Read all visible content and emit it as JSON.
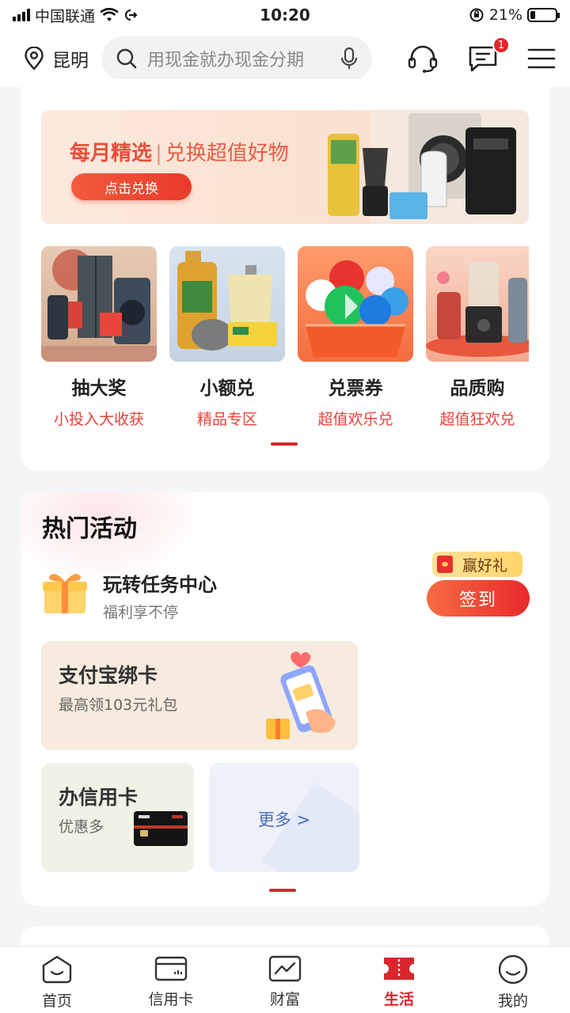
{
  "status_bar": {
    "carrier": "中国联通",
    "time": "10:20",
    "battery": "21%",
    "battery_level": 0.21
  },
  "header": {
    "location": "昆明",
    "search_placeholder": "用现金就办现金分期",
    "message_badge": "1",
    "icons": [
      "location-pin-icon",
      "search-icon",
      "microphone-icon",
      "headset-icon",
      "message-icon",
      "menu-icon"
    ]
  },
  "banner": {
    "title": "每月精选",
    "subtitle": "兑换超值好物",
    "button": "点击兑换"
  },
  "products": [
    {
      "name": "抽大奖",
      "sub": "小投入大收获"
    },
    {
      "name": "小额兑",
      "sub": "精品专区"
    },
    {
      "name": "兑票券",
      "sub": "超值欢乐兑"
    },
    {
      "name": "品质购",
      "sub": "超值狂欢兑"
    }
  ],
  "hot": {
    "title": "热门活动",
    "task_title": "玩转任务中心",
    "task_sub": "福利享不停",
    "win_tag": "赢好礼",
    "sign_button": "签到",
    "tiles": {
      "alipay_title": "支付宝绑卡",
      "alipay_sub": "最高领103元礼包",
      "credit_title": "办信用卡",
      "credit_sub": "优惠多",
      "more": "更多 >"
    }
  },
  "tabbar": [
    {
      "label": "首页",
      "active": false
    },
    {
      "label": "信用卡",
      "active": false
    },
    {
      "label": "财富",
      "active": false
    },
    {
      "label": "生活",
      "active": true
    },
    {
      "label": "我的",
      "active": false
    }
  ],
  "colors": {
    "accent": "#d8262b",
    "banner_red": "#e94f3a",
    "link_blue": "#4a6db5"
  }
}
